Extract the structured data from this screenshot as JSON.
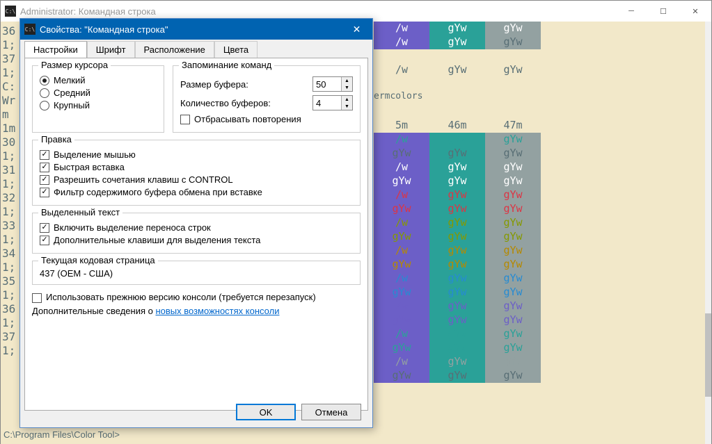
{
  "main_window": {
    "title": "Administrator: Командная строка",
    "icon_text": "C:\\"
  },
  "console": {
    "left_lines": [
      "36",
      "1;",
      "37",
      "1;",
      "",
      "C:",
      "Wr",
      "",
      "m",
      "1m",
      "30",
      "1;",
      "31",
      "1;",
      "32",
      "1;",
      "33",
      "1;",
      "34",
      "1;",
      "35",
      "1;",
      "36",
      "1;",
      "37",
      "1;",
      ""
    ],
    "termcolors_label": "ermcolors",
    "prompt": "C:\\Program Files\\Color Tool>",
    "sample": "gYw",
    "headers": {
      "h45": "5m",
      "h46": "46m",
      "h47": "47m"
    }
  },
  "dialog": {
    "title": "Свойства: \"Командная строка\"",
    "icon_text": "C:\\",
    "tabs": [
      "Настройки",
      "Шрифт",
      "Расположение",
      "Цвета"
    ],
    "cursor_box": {
      "title": "Размер курсора",
      "small": "Мелкий",
      "medium": "Средний",
      "large": "Крупный"
    },
    "history_box": {
      "title": "Запоминание команд",
      "buffer_size_label": "Размер буфера:",
      "buffer_size_value": "50",
      "num_buffers_label": "Количество буферов:",
      "num_buffers_value": "4",
      "discard_dup": "Отбрасывать повторения"
    },
    "edit_box": {
      "title": "Правка",
      "mouse_select": "Выделение мышью",
      "quick_paste": "Быстрая вставка",
      "ctrl_shortcuts": "Разрешить сочетания клавиш с CONTROL",
      "filter_clipboard": "Фильтр содержимого буфера обмена при вставке"
    },
    "selection_box": {
      "title": "Выделенный текст",
      "wrap": "Включить выделение переноса строк",
      "extra_keys": "Дополнительные клавиши для выделения текста"
    },
    "codepage_box": {
      "title": "Текущая кодовая страница",
      "value": "437  (OEM - США)"
    },
    "legacy": "Использовать прежнюю версию консоли (требуется перезапуск)",
    "more_info_prefix": "Дополнительные сведения о ",
    "more_info_link": "новых возможностях консоли",
    "ok": "OK",
    "cancel": "Отмена"
  },
  "chart_data": {
    "type": "table",
    "note": "Terminal color grid; columns 45m/46m/47m background samples with foreground styles per row"
  }
}
